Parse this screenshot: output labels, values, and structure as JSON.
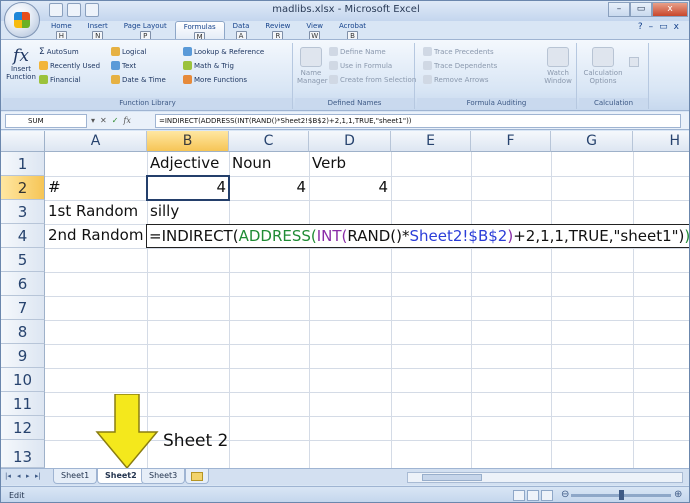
{
  "window": {
    "title": "madlibs.xlsx - Microsoft Excel",
    "minimize": "–",
    "maximize": "▭",
    "close": "x"
  },
  "ribbon_tabs": [
    {
      "label": "Home",
      "key": "H"
    },
    {
      "label": "Insert",
      "key": "N"
    },
    {
      "label": "Page Layout",
      "key": "P"
    },
    {
      "label": "Formulas",
      "key": "M"
    },
    {
      "label": "Data",
      "key": "A"
    },
    {
      "label": "Review",
      "key": "R"
    },
    {
      "label": "View",
      "key": "W"
    },
    {
      "label": "Acrobat",
      "key": "B"
    }
  ],
  "ribbon_right": {
    "help": "?",
    "min": "–",
    "restore": "▭",
    "close": "x"
  },
  "function_library": {
    "label": "Function Library",
    "insert_function": "Insert Function",
    "autosum": "AutoSum",
    "recently_used": "Recently Used",
    "financial": "Financial",
    "logical": "Logical",
    "text": "Text",
    "date_time": "Date & Time",
    "lookup": "Lookup & Reference",
    "math": "Math & Trig",
    "more": "More Functions"
  },
  "defined_names": {
    "label": "Defined Names",
    "name_manager": "Name Manager",
    "define_name": "Define Name",
    "use_in_formula": "Use in Formula",
    "create_from_selection": "Create from Selection"
  },
  "formula_auditing": {
    "label": "Formula Auditing",
    "trace_precedents": "Trace Precedents",
    "trace_dependents": "Trace Dependents",
    "remove_arrows": "Remove Arrows",
    "watch_window": "Watch Window"
  },
  "calculation": {
    "label": "Calculation",
    "options": "Calculation Options"
  },
  "formula_bar": {
    "name_box": "SUM",
    "cancel": "✕",
    "enter": "✓",
    "fx": "fx",
    "formula": "=INDIRECT(ADDRESS(INT(RAND()*Sheet2!$B$2)+2,1,1,TRUE,\"sheet1\"))"
  },
  "columns": [
    "A",
    "B",
    "C",
    "D",
    "E",
    "F",
    "G",
    "H"
  ],
  "rows": [
    "1",
    "2",
    "3",
    "4",
    "5",
    "6",
    "7",
    "8",
    "9",
    "10",
    "11",
    "12",
    "13"
  ],
  "cells": {
    "B1": "Adjective",
    "C1": "Noun",
    "D1": "Verb",
    "A2": "#",
    "B2": "4",
    "C2": "4",
    "D2": "4",
    "A3": "1st Random",
    "B3": "silly",
    "A4": "2nd Random"
  },
  "editing_formula": {
    "p1": "=INDIRECT(",
    "p2": "ADDRESS(",
    "p3": "INT(",
    "p4": "RAND()",
    "p5": "*",
    "p6": "Sheet2!$B$2",
    "p7": ")",
    "p8": "+2,1,1,TRUE,\"sheet1\")",
    "p9": ")"
  },
  "annotation": {
    "text": "Sheet 2",
    "arrow_color": "#f4e81c"
  },
  "sheet_tabs": [
    "Sheet1",
    "Sheet2",
    "Sheet3"
  ],
  "active_sheet": "Sheet2",
  "status": {
    "mode": "Edit"
  },
  "colors": {
    "accent": "#15428b",
    "selected_header": "#f6c556"
  }
}
